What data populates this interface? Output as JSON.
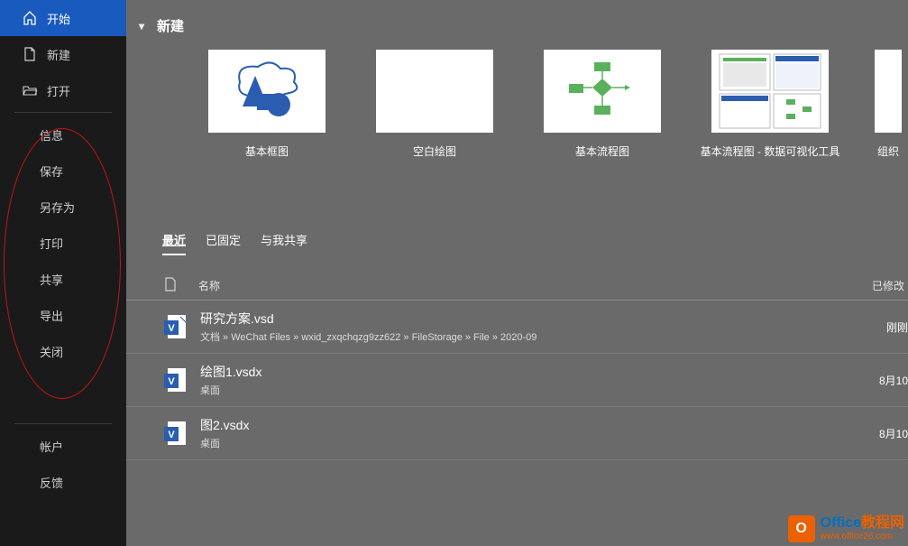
{
  "sidebar": {
    "top": [
      {
        "label": "开始",
        "icon": "home",
        "active": true
      },
      {
        "label": "新建",
        "icon": "new"
      },
      {
        "label": "打开",
        "icon": "open"
      }
    ],
    "mid": [
      {
        "label": "信息"
      },
      {
        "label": "保存"
      },
      {
        "label": "另存为"
      },
      {
        "label": "打印"
      },
      {
        "label": "共享"
      },
      {
        "label": "导出"
      },
      {
        "label": "关闭"
      }
    ],
    "bottom": [
      {
        "label": "帐户"
      },
      {
        "label": "反馈"
      }
    ]
  },
  "new_section": {
    "title": "新建"
  },
  "templates": [
    {
      "label": "基本框图",
      "thumb": "basic-block"
    },
    {
      "label": "空白绘图",
      "thumb": "blank"
    },
    {
      "label": "基本流程图",
      "thumb": "flowchart"
    },
    {
      "label": "基本流程图 - 数据可视化工具",
      "thumb": "flowchart-data"
    },
    {
      "label": "组织",
      "thumb": "org"
    }
  ],
  "tabs": [
    {
      "label": "最近",
      "active": true
    },
    {
      "label": "已固定"
    },
    {
      "label": "与我共享"
    }
  ],
  "columns": {
    "name": "名称",
    "modified": "已修改"
  },
  "files": [
    {
      "name": "研究方案.vsd",
      "path": "文档 » WeChat Files » wxid_zxqchqzg9zz622 » FileStorage » File » 2020-09",
      "modified": "刚刚"
    },
    {
      "name": "绘图1.vsdx",
      "path": "桌面",
      "modified": "8月10"
    },
    {
      "name": "图2.vsdx",
      "path": "桌面",
      "modified": "8月10"
    }
  ],
  "watermark": {
    "title_a": "Office",
    "title_b": "教程网",
    "url": "www.office26.com"
  }
}
